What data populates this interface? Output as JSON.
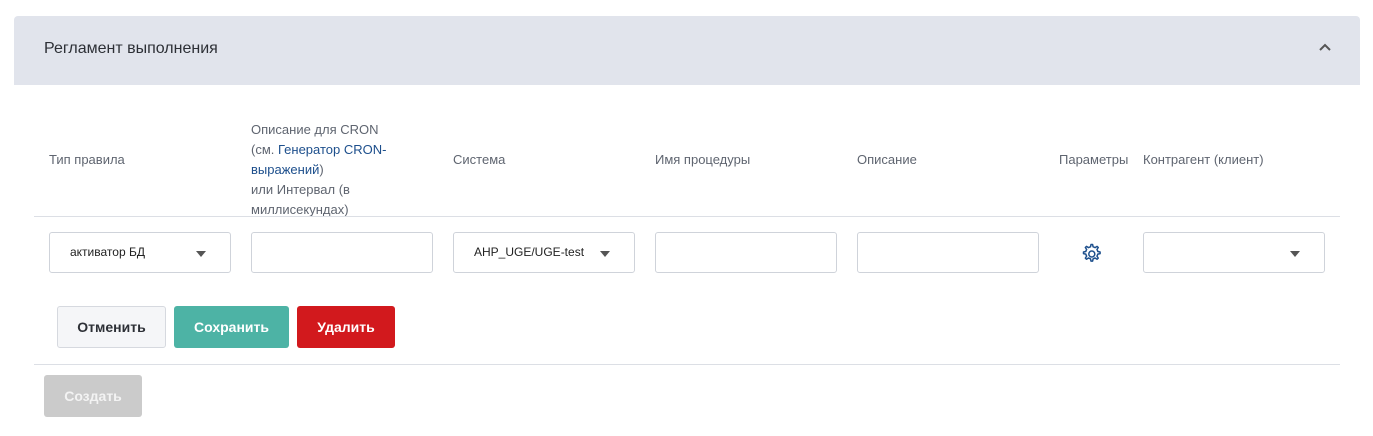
{
  "panel": {
    "title": "Регламент выполнения"
  },
  "table": {
    "headers": {
      "rule_type": "Тип правила",
      "cron_line1": "Описание для CRON",
      "cron_line2_prefix": "(см. ",
      "cron_link": "Генератор CRON-",
      "cron_link2": "выражений",
      "cron_line3_suffix": ")",
      "cron_line4": "или Интервал (в миллисекундах)",
      "system": "Система",
      "procedure_name": "Имя процедуры",
      "description": "Описание",
      "parameters": "Параметры",
      "counterparty": "Контрагент (клиент)"
    },
    "row": {
      "rule_type_value": "активатор БД",
      "cron_value": "",
      "system_value": "AHP_UGE/UGE-test",
      "procedure_value": "",
      "description_value": "",
      "counterparty_value": ""
    }
  },
  "actions": {
    "cancel": "Отменить",
    "save": "Сохранить",
    "delete": "Удалить",
    "create": "Создать"
  },
  "colors": {
    "header_bg": "#e1e4ec",
    "save": "#4db3a5",
    "delete": "#d2191d",
    "create_disabled": "#cbcbcb",
    "link": "#1d4f8c"
  }
}
